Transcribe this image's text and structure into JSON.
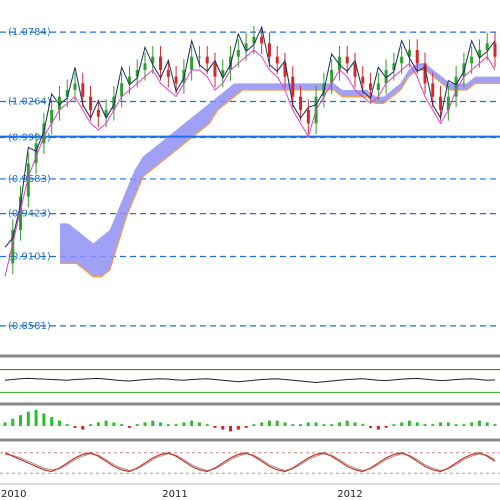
{
  "colors": {
    "background": "#ffffff",
    "fib_line": "#1e6fe0",
    "fib_label": "#1f6fd0",
    "support_line": "#1a73e8",
    "cloud_fill": "#8f8ff5",
    "cloud_edge_orange": "#f0a050",
    "candle_up": "#2ca02c",
    "candle_down": "#d62728",
    "price_line_dark": "#1b2a5a",
    "price_line_magenta": "#e040c0",
    "panel_separator": "#888888",
    "rsi_line": "#222222",
    "rsi_top": "#cc2222",
    "rsi_bottom": "#22aa22",
    "histogram_up": "#2bbf2b",
    "histogram_down": "#d02020",
    "stoch_k": "#d03020",
    "stoch_d": "#9a9a9a"
  },
  "chart_data": {
    "type": "candlestick",
    "title": "",
    "ylabel": "",
    "xlabel": "",
    "ylim": [
      0.84,
      1.095
    ],
    "xticks": [
      "2010",
      "2011",
      "2012"
    ],
    "xtick_fraction": [
      0.0,
      0.35,
      0.7
    ],
    "fib_levels": [
      {
        "label": "(1.0784)",
        "value": 1.0784
      },
      {
        "label": "(1.0264)",
        "value": 1.0264
      },
      {
        "label": "(0.9994)",
        "value": 0.9994
      },
      {
        "label": "(0.9683)",
        "value": 0.9683
      },
      {
        "label": "(0.9423)",
        "value": 0.9423
      },
      {
        "label": "(0.9101)",
        "value": 0.9101
      },
      {
        "label": "(0.8581)",
        "value": 0.8581
      }
    ],
    "support_value": 1.0,
    "close_series": [
      0.905,
      0.93,
      0.955,
      0.98,
      0.995,
      1.01,
      1.02,
      1.03,
      1.035,
      1.04,
      1.03,
      1.02,
      1.015,
      1.02,
      1.03,
      1.04,
      1.045,
      1.05,
      1.055,
      1.06,
      1.05,
      1.045,
      1.04,
      1.05,
      1.06,
      1.06,
      1.055,
      1.045,
      1.05,
      1.06,
      1.065,
      1.07,
      1.075,
      1.07,
      1.06,
      1.055,
      1.045,
      1.03,
      1.02,
      1.01,
      1.03,
      1.04,
      1.05,
      1.06,
      1.055,
      1.045,
      1.04,
      1.035,
      1.04,
      1.05,
      1.055,
      1.06,
      1.065,
      1.055,
      1.04,
      1.03,
      1.02,
      1.03,
      1.045,
      1.055,
      1.06,
      1.065,
      1.07,
      1.06
    ],
    "cloud_top": [
      0.905,
      0.905,
      0.905,
      0.9,
      0.895,
      0.895,
      0.9,
      0.92,
      0.94,
      0.955,
      0.97,
      0.975,
      0.98,
      0.985,
      0.99,
      0.995,
      1.0,
      1.005,
      1.01,
      1.02,
      1.025,
      1.03,
      1.035,
      1.035,
      1.035,
      1.035,
      1.035,
      1.035,
      1.035,
      1.035,
      1.035,
      1.035,
      1.035,
      1.035,
      1.03,
      1.03,
      1.03,
      1.03,
      1.025,
      1.025,
      1.03,
      1.035,
      1.045,
      1.05,
      1.05,
      1.045,
      1.04,
      1.035,
      1.035,
      1.035,
      1.04,
      1.04,
      1.04,
      1.04
    ],
    "cloud_bottom": [
      0.935,
      0.935,
      0.93,
      0.925,
      0.92,
      0.925,
      0.93,
      0.945,
      0.96,
      0.975,
      0.985,
      0.99,
      0.995,
      1.0,
      1.005,
      1.01,
      1.015,
      1.02,
      1.025,
      1.03,
      1.035,
      1.04,
      1.04,
      1.04,
      1.04,
      1.04,
      1.04,
      1.04,
      1.04,
      1.04,
      1.04,
      1.04,
      1.04,
      1.04,
      1.035,
      1.035,
      1.035,
      1.035,
      1.03,
      1.03,
      1.035,
      1.04,
      1.05,
      1.055,
      1.055,
      1.05,
      1.045,
      1.04,
      1.04,
      1.04,
      1.045,
      1.045,
      1.045,
      1.045
    ],
    "rsi": [
      52,
      54,
      56,
      57,
      56,
      55,
      54,
      53,
      52,
      54,
      55,
      56,
      57,
      55,
      53,
      51,
      50,
      52,
      54,
      55,
      56,
      55,
      53,
      52,
      54,
      55,
      56,
      54,
      52,
      50,
      48,
      50,
      52,
      54,
      55,
      56,
      54,
      52,
      50,
      48,
      46,
      48,
      50,
      52,
      54,
      55,
      56,
      54,
      52,
      51,
      53,
      55,
      56,
      57,
      55,
      53,
      51,
      52,
      54,
      55,
      56,
      54,
      52,
      53
    ],
    "histogram": [
      0.2,
      0.4,
      0.6,
      0.8,
      0.9,
      0.7,
      0.5,
      0.3,
      0.1,
      -0.1,
      -0.2,
      0.1,
      0.2,
      0.3,
      0.2,
      0.1,
      -0.1,
      0.1,
      0.2,
      0.3,
      0.2,
      0.1,
      0.1,
      0.2,
      0.3,
      0.2,
      0.1,
      -0.1,
      -0.2,
      -0.3,
      -0.2,
      -0.1,
      0.1,
      0.2,
      0.3,
      0.3,
      0.2,
      0.1,
      0.1,
      0.2,
      0.2,
      0.1,
      0.1,
      0.2,
      0.3,
      0.2,
      0.1,
      -0.1,
      -0.2,
      -0.1,
      0.1,
      0.2,
      0.3,
      0.2,
      0.1,
      0.1,
      0.2,
      0.2,
      0.1,
      0.1,
      0.2,
      0.3,
      0.2,
      0.1
    ],
    "stoch_k": [
      80,
      70,
      60,
      50,
      40,
      30,
      25,
      35,
      50,
      65,
      75,
      80,
      70,
      55,
      40,
      30,
      25,
      35,
      50,
      65,
      75,
      80,
      70,
      55,
      40,
      30,
      25,
      35,
      50,
      65,
      75,
      80,
      70,
      55,
      40,
      30,
      25,
      35,
      50,
      65,
      75,
      80,
      70,
      55,
      40,
      30,
      25,
      35,
      50,
      65,
      75,
      80,
      70,
      55,
      40,
      30,
      25,
      35,
      50,
      65,
      75,
      80,
      70,
      55
    ],
    "stoch_d": [
      75,
      72,
      65,
      55,
      45,
      35,
      30,
      33,
      45,
      60,
      70,
      77,
      73,
      60,
      45,
      35,
      28,
      33,
      45,
      60,
      70,
      77,
      73,
      60,
      45,
      35,
      28,
      33,
      45,
      60,
      70,
      77,
      73,
      60,
      45,
      35,
      28,
      33,
      45,
      60,
      70,
      77,
      73,
      60,
      45,
      35,
      28,
      33,
      45,
      60,
      70,
      77,
      73,
      60,
      45,
      35,
      28,
      33,
      45,
      60,
      70,
      77,
      73,
      60
    ]
  }
}
